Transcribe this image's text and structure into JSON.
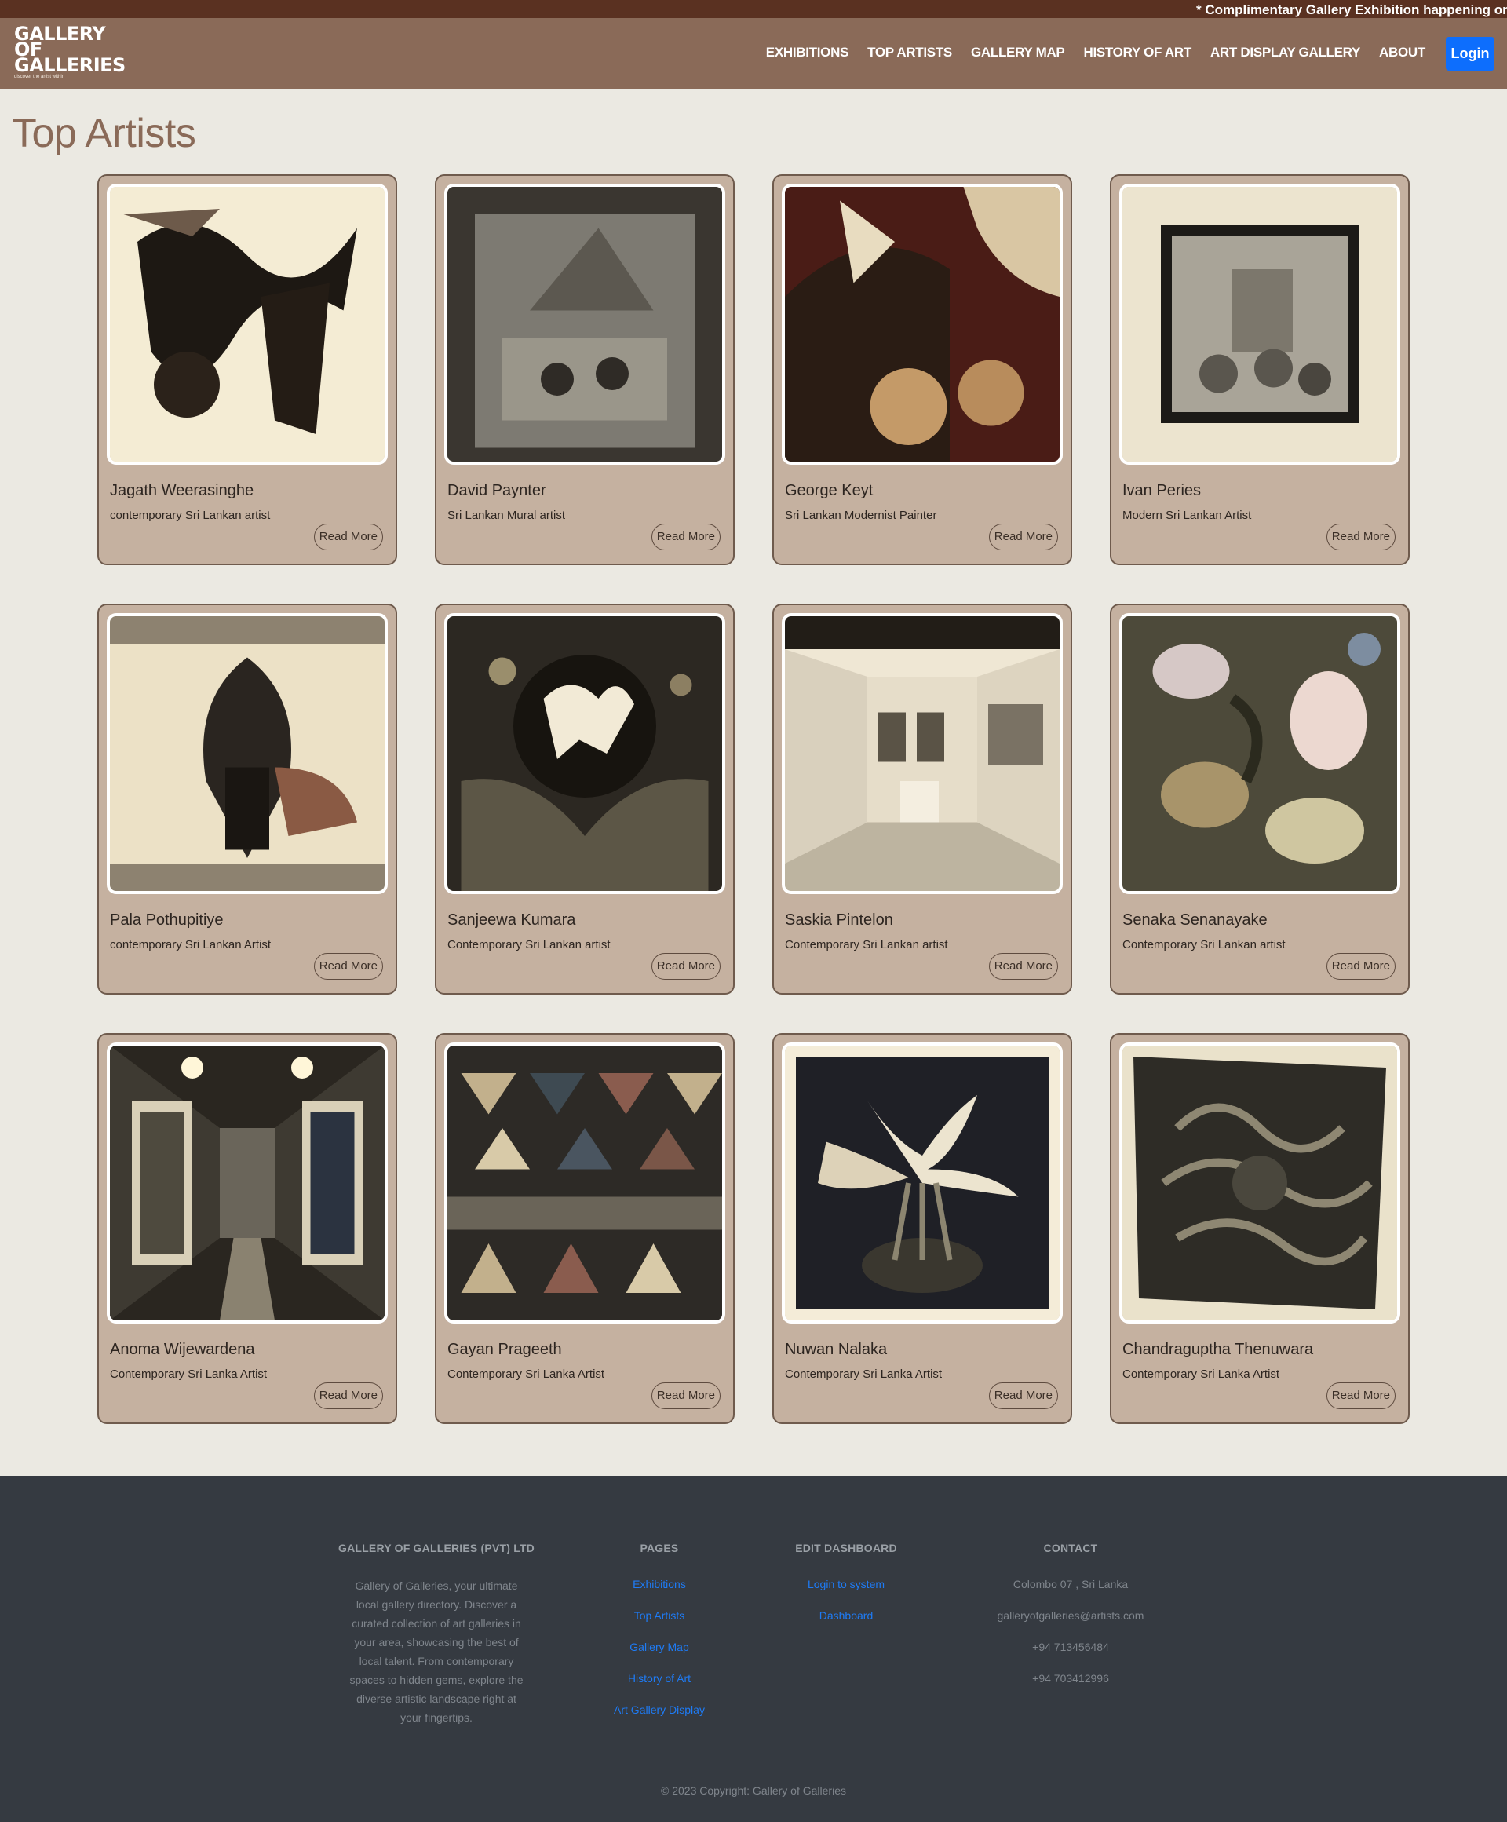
{
  "announcement": "* Complimentary Gallery Exhibition happening on Tu",
  "logo": {
    "line1": "GALLERY",
    "line2": "OF",
    "line3": "GALLERIES",
    "tagline": "discover the artist within"
  },
  "nav": [
    "EXHIBITIONS",
    "TOP ARTISTS",
    "GALLERY MAP",
    "HISTORY OF ART",
    "ART DISPLAY GALLERY",
    "ABOUT"
  ],
  "login_label": "Login",
  "page_title": "Top Artists",
  "read_more": "Read More",
  "artists": [
    {
      "name": "Jagath Weerasinghe",
      "desc": "contemporary Sri Lankan artist"
    },
    {
      "name": "David Paynter",
      "desc": "Sri Lankan Mural artist"
    },
    {
      "name": "George Keyt",
      "desc": "Sri Lankan Modernist Painter"
    },
    {
      "name": "Ivan Peries",
      "desc": "Modern Sri Lankan Artist"
    },
    {
      "name": "Pala Pothupitiye",
      "desc": "contemporary Sri Lankan Artist"
    },
    {
      "name": "Sanjeewa Kumara",
      "desc": "Contemporary Sri Lankan artist"
    },
    {
      "name": "Saskia Pintelon",
      "desc": "Contemporary Sri Lankan artist"
    },
    {
      "name": "Senaka Senanayake",
      "desc": "Contemporary Sri Lankan artist"
    },
    {
      "name": "Anoma Wijewardena",
      "desc": "Contemporary Sri Lanka Artist"
    },
    {
      "name": "Gayan Prageeth",
      "desc": "Contemporary Sri Lanka Artist"
    },
    {
      "name": "Nuwan Nalaka",
      "desc": "Contemporary Sri Lanka Artist"
    },
    {
      "name": "Chandraguptha Thenuwara",
      "desc": "Contemporary Sri Lanka Artist"
    }
  ],
  "footer": {
    "company": {
      "title": "GALLERY OF GALLERIES (PVT) LTD",
      "lines": [
        "Gallery of Galleries, your ultimate",
        "local gallery directory. Discover a",
        "curated collection of art galleries in",
        "your area, showcasing the best of",
        "local talent. From contemporary",
        "spaces to hidden gems, explore the",
        "diverse artistic landscape right at",
        "your fingertips."
      ]
    },
    "pages": {
      "title": "PAGES",
      "links": [
        "Exhibitions",
        "Top Artists",
        "Gallery Map",
        "History of Art",
        "Art Gallery Display"
      ]
    },
    "dashboard": {
      "title": "EDIT DASHBOARD",
      "links": [
        "Login to system",
        "Dashboard"
      ]
    },
    "contact": {
      "title": "CONTACT",
      "lines": [
        "Colombo 07 , Sri Lanka",
        "galleryofgalleries@artists.com",
        "+94 713456484",
        "+94 703412996"
      ]
    },
    "copyright": "© 2023 Copyright: Gallery of Galleries"
  },
  "colors": {
    "marquee": "#5a3121",
    "navbar": "#8a6a58",
    "login": "#0d6efd",
    "card": "#c5b1a0",
    "footer": "#353a41",
    "link": "#1e7bf5"
  }
}
